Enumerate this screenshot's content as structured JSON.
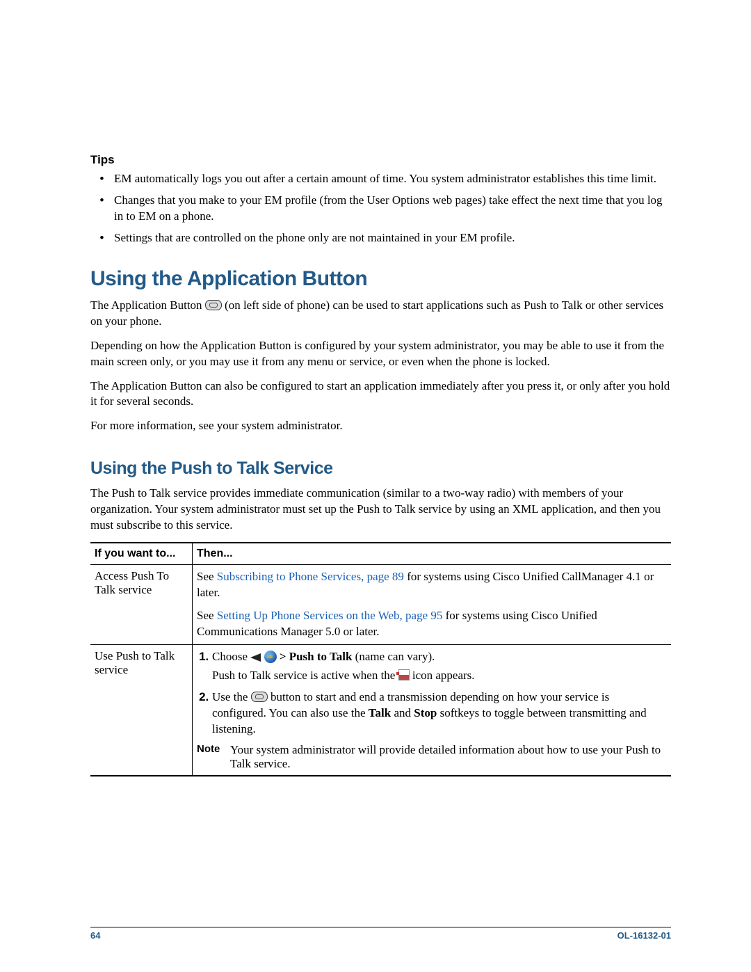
{
  "tips": {
    "heading": "Tips",
    "items": [
      "EM automatically logs you out after a certain amount of time. You system administrator establishes this time limit.",
      "Changes that you make to your EM profile (from the User Options web pages) take effect the next time that you log in to EM on a phone.",
      "Settings that are controlled on the phone only are not maintained in your EM profile."
    ]
  },
  "section1": {
    "heading": "Using the Application Button",
    "p1a": "The Application Button ",
    "p1b": " (on left side of phone) can be used to start applications such as Push to Talk or other services on your phone.",
    "p2": "Depending on how the Application Button is configured by your system administrator, you may be able to use it from the main screen only, or you may use it from any menu or service, or even when the phone is locked.",
    "p3": "The Application Button can also be configured to start an application immediately after you press it, or only after you hold it for several seconds.",
    "p4": "For more information, see your system administrator."
  },
  "section2": {
    "heading": "Using the Push to Talk Service",
    "intro": "The Push to Talk service provides immediate communication (similar to a two-way radio) with members of your organization. Your system administrator must set up the Push to Talk service by using an XML application, and then you must subscribe to this service."
  },
  "table": {
    "col1_header": "If you want to...",
    "col2_header": "Then...",
    "row1": {
      "c1": "Access Push To Talk service",
      "see1": "See ",
      "link1": "Subscribing to Phone Services, page 89",
      "after1": " for systems using Cisco Unified CallManager 4.1 or later.",
      "see2": "See ",
      "link2": "Setting Up Phone Services on the Web, page 95",
      "after2": " for systems using Cisco Unified Communications Manager 5.0 or later."
    },
    "row2": {
      "c1": "Use Push to Talk service",
      "step1_prefix": "Choose ",
      "step1_sep": " > ",
      "step1_bold": "Push to Talk",
      "step1_suffix": " (name can vary).",
      "step1_note_a": "Push to Talk service is active when the ",
      "step1_note_b": " icon appears.",
      "step2_a": "Use the ",
      "step2_b": " button to start and end a transmission depending on how your service is configured. You can also use the ",
      "step2_talk": "Talk",
      "step2_and": " and ",
      "step2_stop": "Stop",
      "step2_c": " softkeys to toggle between transmitting and listening.",
      "note_label": "Note",
      "note_text": "Your system administrator will provide detailed information about how to use your Push to Talk service."
    }
  },
  "footer": {
    "page": "64",
    "doc": "OL-16132-01"
  }
}
